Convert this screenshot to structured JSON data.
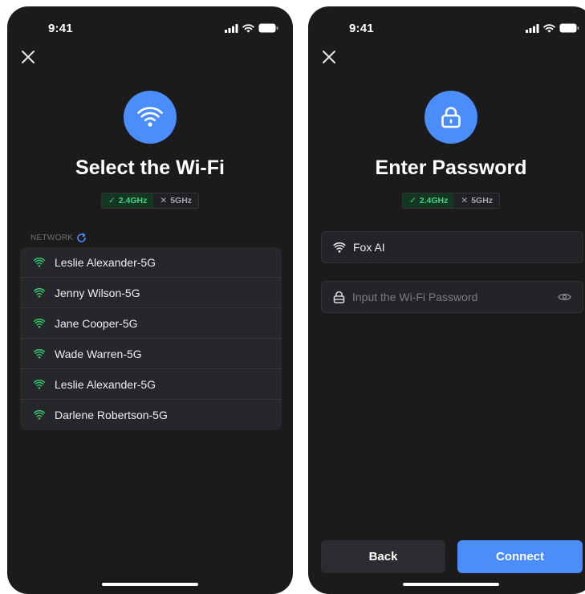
{
  "status_bar": {
    "time": "9:41"
  },
  "select_screen": {
    "title": "Select the Wi-Fi",
    "bands": {
      "on": "2.4GHz",
      "off": "5GHz"
    },
    "network_label": "NETWORK",
    "networks": [
      "Leslie Alexander-5G",
      "Jenny Wilson-5G",
      "Jane Cooper-5G",
      "Wade Warren-5G",
      "Leslie Alexander-5G",
      "Darlene Robertson-5G"
    ]
  },
  "password_screen": {
    "title": "Enter Password",
    "bands": {
      "on": "2.4GHz",
      "off": "5GHz"
    },
    "ssid": "Fox AI",
    "password_placeholder": "Input the Wi-Fi Password",
    "back_label": "Back",
    "connect_label": "Connect"
  },
  "colors": {
    "accent": "#4a8dfb",
    "background": "#1b1b1c",
    "signal_green": "#37c96d"
  },
  "icons": [
    "wifi-icon",
    "lock-icon",
    "close-icon",
    "refresh-icon",
    "eye-icon",
    "signal-icon",
    "battery-icon"
  ]
}
